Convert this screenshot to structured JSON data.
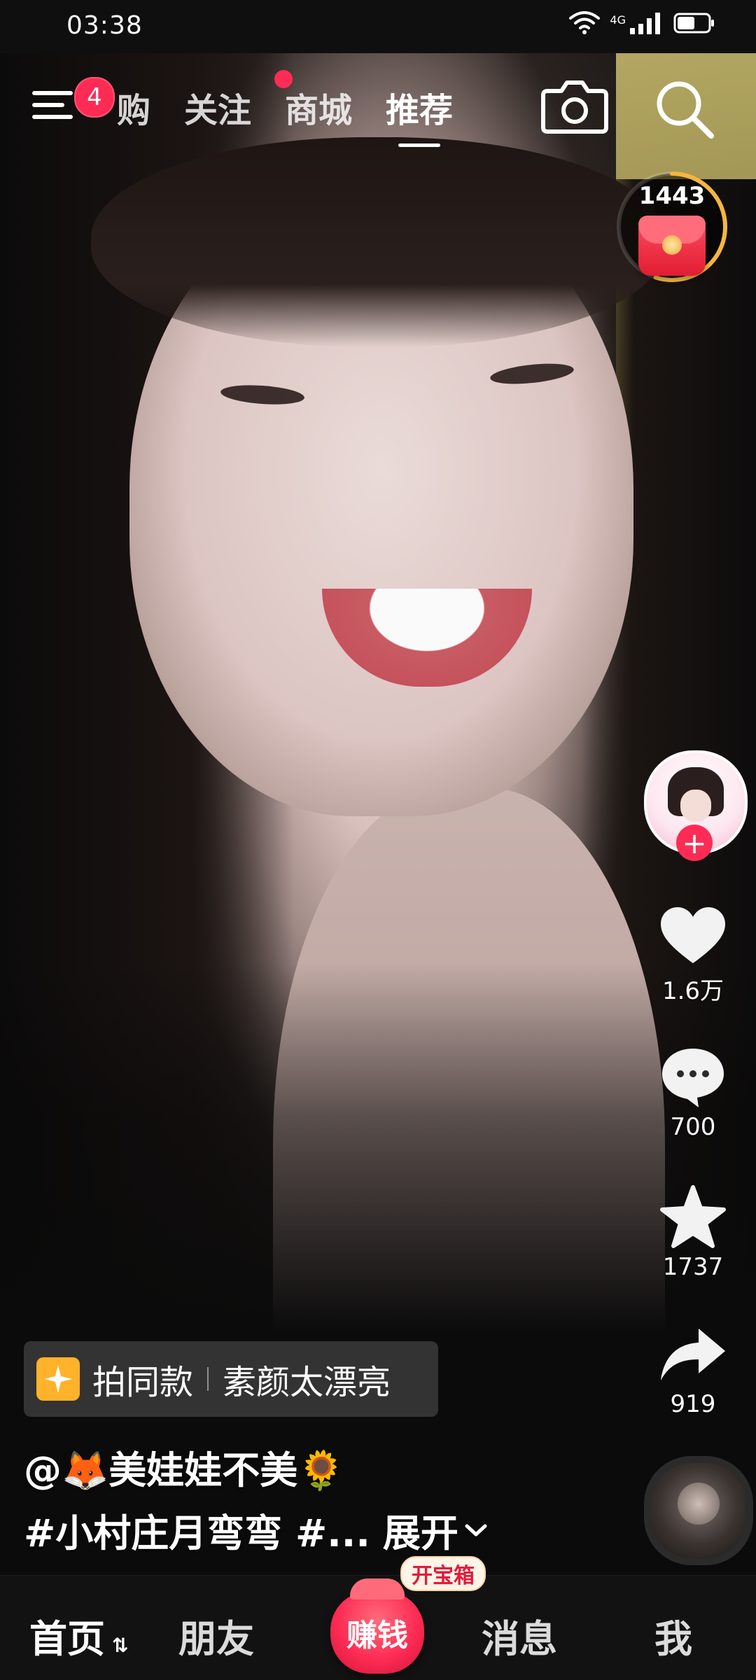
{
  "status_bar": {
    "time": "03:38",
    "network": "4G"
  },
  "top_nav": {
    "menu_badge": "4",
    "tabs": [
      {
        "label": "购"
      },
      {
        "label": "关注"
      },
      {
        "label": "商城"
      },
      {
        "label": "推荐"
      }
    ],
    "active_tab": "推荐"
  },
  "reward": {
    "count": "1443",
    "progress": 0.55
  },
  "right_rail": {
    "likes": "1.6万",
    "comments": "700",
    "favorites": "1737",
    "shares": "919"
  },
  "caption": {
    "chip_action": "拍同款",
    "chip_topic": "素颜太漂亮",
    "author": "@🦊美娃娃不美🌻",
    "description": "#小村庄月弯弯 #...",
    "expand": "展开"
  },
  "bottom_nav": {
    "home": "首页",
    "friends": "朋友",
    "earn": "赚钱",
    "earn_tag": "开宝箱",
    "messages": "消息",
    "me": "我"
  },
  "colors": {
    "accent": "#fe2c55",
    "nav_bg": "#121212"
  }
}
